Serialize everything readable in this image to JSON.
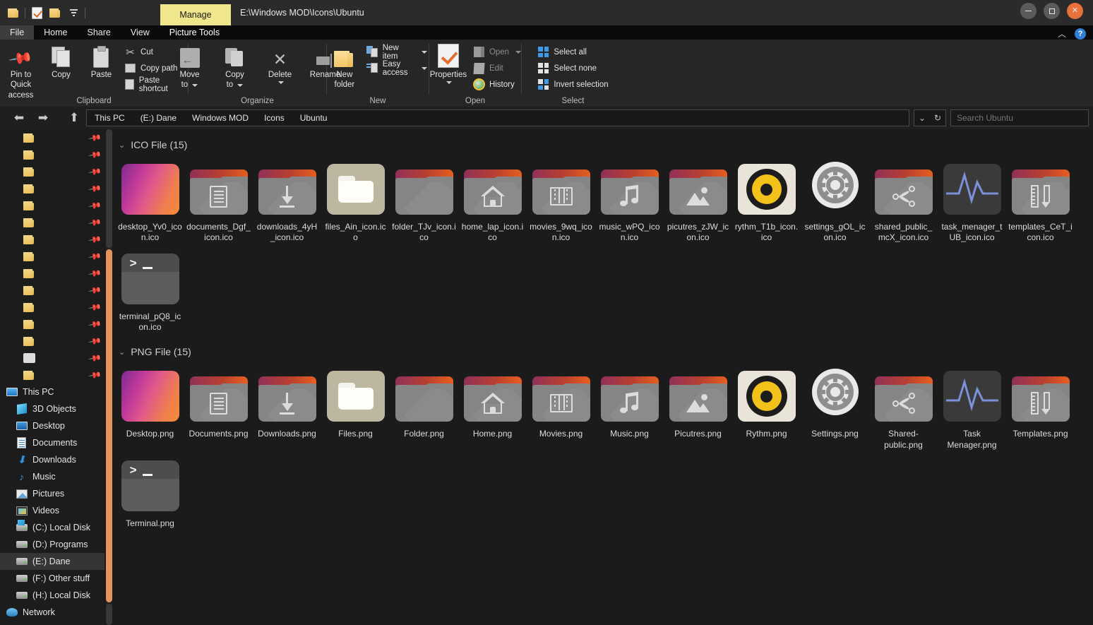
{
  "window": {
    "path_title": "E:\\Windows MOD\\Icons\\Ubuntu",
    "contextual_tab": "Manage",
    "controls": {
      "minimize": "minimize-button",
      "maximize": "maximize-button",
      "close": "close-button"
    }
  },
  "quick_access_toolbar": [
    {
      "name": "folder-icon",
      "label": ""
    },
    {
      "name": "properties-icon",
      "label": ""
    },
    {
      "name": "new-folder-icon",
      "label": ""
    },
    {
      "name": "customize-dropdown",
      "label": ""
    }
  ],
  "tabs": [
    {
      "label": "File",
      "active": true
    },
    {
      "label": "Home",
      "active": false
    },
    {
      "label": "Share",
      "active": false
    },
    {
      "label": "View",
      "active": false
    },
    {
      "label": "Picture Tools",
      "active": false
    }
  ],
  "ribbon": {
    "groups": [
      {
        "label": "Clipboard",
        "big": [
          {
            "label": "Pin to Quick\naccess",
            "icon": "pin-icon"
          },
          {
            "label": "Copy",
            "icon": "copy-icon"
          },
          {
            "label": "Paste",
            "icon": "paste-icon"
          }
        ],
        "small": [
          {
            "label": "Cut",
            "icon": "scissors-icon"
          },
          {
            "label": "Copy path",
            "icon": "copy-path-icon"
          },
          {
            "label": "Paste shortcut",
            "icon": "paste-shortcut-icon"
          }
        ]
      },
      {
        "label": "Organize",
        "big": [
          {
            "label": "Move\nto",
            "icon": "move-to-icon",
            "dropdown": true
          },
          {
            "label": "Copy\nto",
            "icon": "copy-to-icon",
            "dropdown": true
          },
          {
            "label": "Delete",
            "icon": "delete-icon",
            "dropdown": true
          },
          {
            "label": "Rename",
            "icon": "rename-icon"
          }
        ],
        "small": []
      },
      {
        "label": "New",
        "big": [
          {
            "label": "New\nfolder",
            "icon": "new-folder-icon"
          }
        ],
        "small": [
          {
            "label": "New item",
            "icon": "new-item-icon",
            "dropdown": true
          },
          {
            "label": "Easy access",
            "icon": "easy-access-icon",
            "dropdown": true
          }
        ]
      },
      {
        "label": "Open",
        "big": [
          {
            "label": "Properties",
            "icon": "properties-icon",
            "dropdown": true
          }
        ],
        "small": [
          {
            "label": "Open",
            "icon": "open-icon",
            "dropdown": true,
            "dim": true
          },
          {
            "label": "Edit",
            "icon": "edit-icon",
            "dim": true
          },
          {
            "label": "History",
            "icon": "history-icon"
          }
        ]
      },
      {
        "label": "Select",
        "big": [],
        "small": [
          {
            "label": "Select all",
            "icon": "select-all-icon"
          },
          {
            "label": "Select none",
            "icon": "select-none-icon"
          },
          {
            "label": "Invert selection",
            "icon": "invert-selection-icon"
          }
        ]
      }
    ]
  },
  "address_bar": {
    "back": "back-arrow-icon",
    "forward": "forward-arrow-icon",
    "up": "up-arrow-icon",
    "breadcrumbs": [
      "This PC",
      "(E:) Dane",
      "Windows MOD",
      "Icons",
      "Ubuntu"
    ],
    "dropdown": "chevron-down-icon",
    "refresh": "refresh-icon",
    "search_placeholder": "Search Ubuntu",
    "search_value": ""
  },
  "sidebar": {
    "quick_access_pinned_count": 15,
    "items": [
      {
        "label": "This PC",
        "icon": "this-pc-icon",
        "level": 0,
        "selected": false
      },
      {
        "label": "3D Objects",
        "icon": "3d-objects-icon",
        "level": 1,
        "selected": false
      },
      {
        "label": "Desktop",
        "icon": "desktop-icon",
        "level": 1,
        "selected": false
      },
      {
        "label": "Documents",
        "icon": "documents-icon",
        "level": 1,
        "selected": false
      },
      {
        "label": "Downloads",
        "icon": "downloads-icon",
        "level": 1,
        "selected": false
      },
      {
        "label": "Music",
        "icon": "music-icon",
        "level": 1,
        "selected": false
      },
      {
        "label": "Pictures",
        "icon": "pictures-icon",
        "level": 1,
        "selected": false
      },
      {
        "label": "Videos",
        "icon": "videos-icon",
        "level": 1,
        "selected": false
      },
      {
        "label": "(C:) Local Disk",
        "icon": "windows-drive-icon",
        "level": 1,
        "selected": false
      },
      {
        "label": "(D:) Programs",
        "icon": "drive-icon",
        "level": 1,
        "selected": false
      },
      {
        "label": "(E:) Dane",
        "icon": "drive-icon",
        "level": 1,
        "selected": true
      },
      {
        "label": "(F:) Other stuff",
        "icon": "drive-icon",
        "level": 1,
        "selected": false
      },
      {
        "label": "(H:) Local Disk",
        "icon": "drive-icon",
        "level": 1,
        "selected": false
      },
      {
        "label": "Network",
        "icon": "network-icon",
        "level": 0,
        "selected": false
      }
    ]
  },
  "content": {
    "groups": [
      {
        "header": "ICO File (15)",
        "collapse_icon": "chevron-down-icon",
        "files": [
          {
            "name": "desktop_Yv0_icon.ico",
            "icon": "desktop-gradient-icon"
          },
          {
            "name": "documents_Dgf_icon.ico",
            "icon": "documents-folder-icon"
          },
          {
            "name": "downloads_4yH_icon.ico",
            "icon": "downloads-folder-icon"
          },
          {
            "name": "files_Ain_icon.ico",
            "icon": "files-nautilus-icon"
          },
          {
            "name": "folder_TJv_icon.ico",
            "icon": "plain-folder-icon"
          },
          {
            "name": "home_lap_icon.ico",
            "icon": "home-folder-icon"
          },
          {
            "name": "movies_9wq_icon.ico",
            "icon": "movies-folder-icon"
          },
          {
            "name": "music_wPQ_icon.ico",
            "icon": "music-folder-icon"
          },
          {
            "name": "picutres_zJW_icon.ico",
            "icon": "pictures-folder-icon"
          },
          {
            "name": "rythm_T1b_icon.ico",
            "icon": "rhythmbox-icon"
          },
          {
            "name": "settings_gOL_icon.ico",
            "icon": "settings-gear-icon"
          },
          {
            "name": "shared_public_mcX_icon.ico",
            "icon": "shared-folder-icon"
          },
          {
            "name": "task_menager_tUB_icon.ico",
            "icon": "task-manager-icon"
          },
          {
            "name": "templates_CeT_icon.ico",
            "icon": "templates-folder-icon"
          },
          {
            "name": "terminal_pQ8_icon.ico",
            "icon": "terminal-icon"
          }
        ]
      },
      {
        "header": "PNG File (15)",
        "collapse_icon": "chevron-down-icon",
        "files": [
          {
            "name": "Desktop.png",
            "icon": "desktop-gradient-icon"
          },
          {
            "name": "Documents.png",
            "icon": "documents-folder-icon"
          },
          {
            "name": "Downloads.png",
            "icon": "downloads-folder-icon"
          },
          {
            "name": "Files.png",
            "icon": "files-nautilus-icon"
          },
          {
            "name": "Folder.png",
            "icon": "plain-folder-icon"
          },
          {
            "name": "Home.png",
            "icon": "home-folder-icon"
          },
          {
            "name": "Movies.png",
            "icon": "movies-folder-icon"
          },
          {
            "name": "Music.png",
            "icon": "music-folder-icon"
          },
          {
            "name": "Picutres.png",
            "icon": "pictures-folder-icon"
          },
          {
            "name": "Rythm.png",
            "icon": "rhythmbox-icon"
          },
          {
            "name": "Settings.png",
            "icon": "settings-gear-icon"
          },
          {
            "name": "Shared-public.png",
            "icon": "shared-folder-icon"
          },
          {
            "name": "Task Menager.png",
            "icon": "task-manager-icon"
          },
          {
            "name": "Templates.png",
            "icon": "templates-folder-icon"
          },
          {
            "name": "Terminal.png",
            "icon": "terminal-icon"
          }
        ]
      }
    ]
  },
  "colors": {
    "accent_orange": "#e8703a",
    "scrollbar_thumb": "#e3955c",
    "manage_tab": "#f0e68c",
    "window_bg": "#1b1b1b",
    "ribbon_bg": "#262626"
  }
}
